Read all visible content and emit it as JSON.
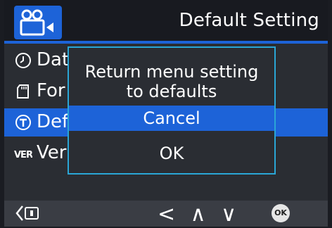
{
  "header": {
    "title": "Default Setting",
    "mode_icon": "camera-mode-icon",
    "accent": "#1d63d8"
  },
  "menu": {
    "items": [
      {
        "label": "Dat",
        "icon": "clock-icon"
      },
      {
        "label": "For",
        "icon": "sd-card-icon"
      },
      {
        "label": "Def",
        "icon": "default-t-icon",
        "selected": true
      },
      {
        "label": "Ver",
        "icon": "version-icon"
      }
    ]
  },
  "dialog": {
    "line1": "Return menu setting",
    "line2": "to defaults",
    "cancel": "Cancel",
    "ok": "OK",
    "border_color": "#2aa6d6"
  },
  "footer": {
    "back": "<",
    "nav": "< ∧ ∨",
    "ok": "OK"
  }
}
